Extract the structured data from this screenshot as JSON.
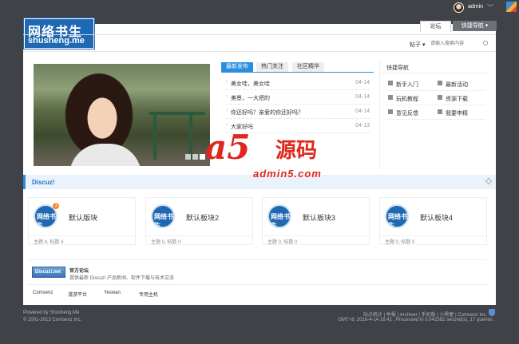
{
  "header": {
    "username": "admin",
    "logo_cn": "网络书生",
    "logo_en": "shusheng.me",
    "nav_forum": "论坛",
    "nav_quick": "快捷导航",
    "search_select": "帖子",
    "search_placeholder": "请输入搜索内容"
  },
  "news": {
    "tabs": [
      "最新发布",
      "热门关注",
      "社区精华"
    ],
    "items": [
      {
        "title": "美女哇，美女哇",
        "date": "04-14"
      },
      {
        "title": "美景，一大把的",
        "date": "04-14"
      },
      {
        "title": "你还好吗？亲爱的你还好吗？",
        "date": "04-14"
      },
      {
        "title": "大家好吗",
        "date": "04-13"
      }
    ]
  },
  "quicknav": {
    "title": "快捷导航",
    "items": [
      "新手入门",
      "最新活动",
      "玩机教程",
      "资源下载",
      "意见反馈",
      "我要申精"
    ]
  },
  "watermark": {
    "a5": "a5",
    "cn": "源码",
    "url": "admin5.com"
  },
  "section": {
    "title": "Discuz!"
  },
  "boards": [
    {
      "name": "默认版块",
      "stats": "主题 4, 帖数 4",
      "badge": "3",
      "logo": "网络书生"
    },
    {
      "name": "默认板块2",
      "stats": "主题 0, 帖数 0",
      "badge": "",
      "logo": "网络书生"
    },
    {
      "name": "默认板块3",
      "stats": "主题 0, 帖数 0",
      "badge": "",
      "logo": "网络书生"
    },
    {
      "name": "默认板块4",
      "stats": "主题 0, 帖数 0",
      "badge": "",
      "logo": "网络书生"
    }
  ],
  "official": {
    "logo_text": "Discuz!.net",
    "title": "官方论坛",
    "desc": "提供最新 Discuz! 产品新闻、软件下载与技术交流"
  },
  "friend_links": [
    "Comsenz",
    "漫游平台",
    "Yeswan",
    "专用主机"
  ],
  "footer": {
    "left1": "Powered by Shusheng.Me",
    "left2": "© 2001-2013 Comsenz Inc.",
    "right1": "站点统计 | 举报 | Archiver | 手机版 | 小黑屋 | Comsenz Inc.",
    "right2": "GMT+8, 2016-4-14 16:41 , Processed in 0.042382 second(s), 17 queries ."
  }
}
